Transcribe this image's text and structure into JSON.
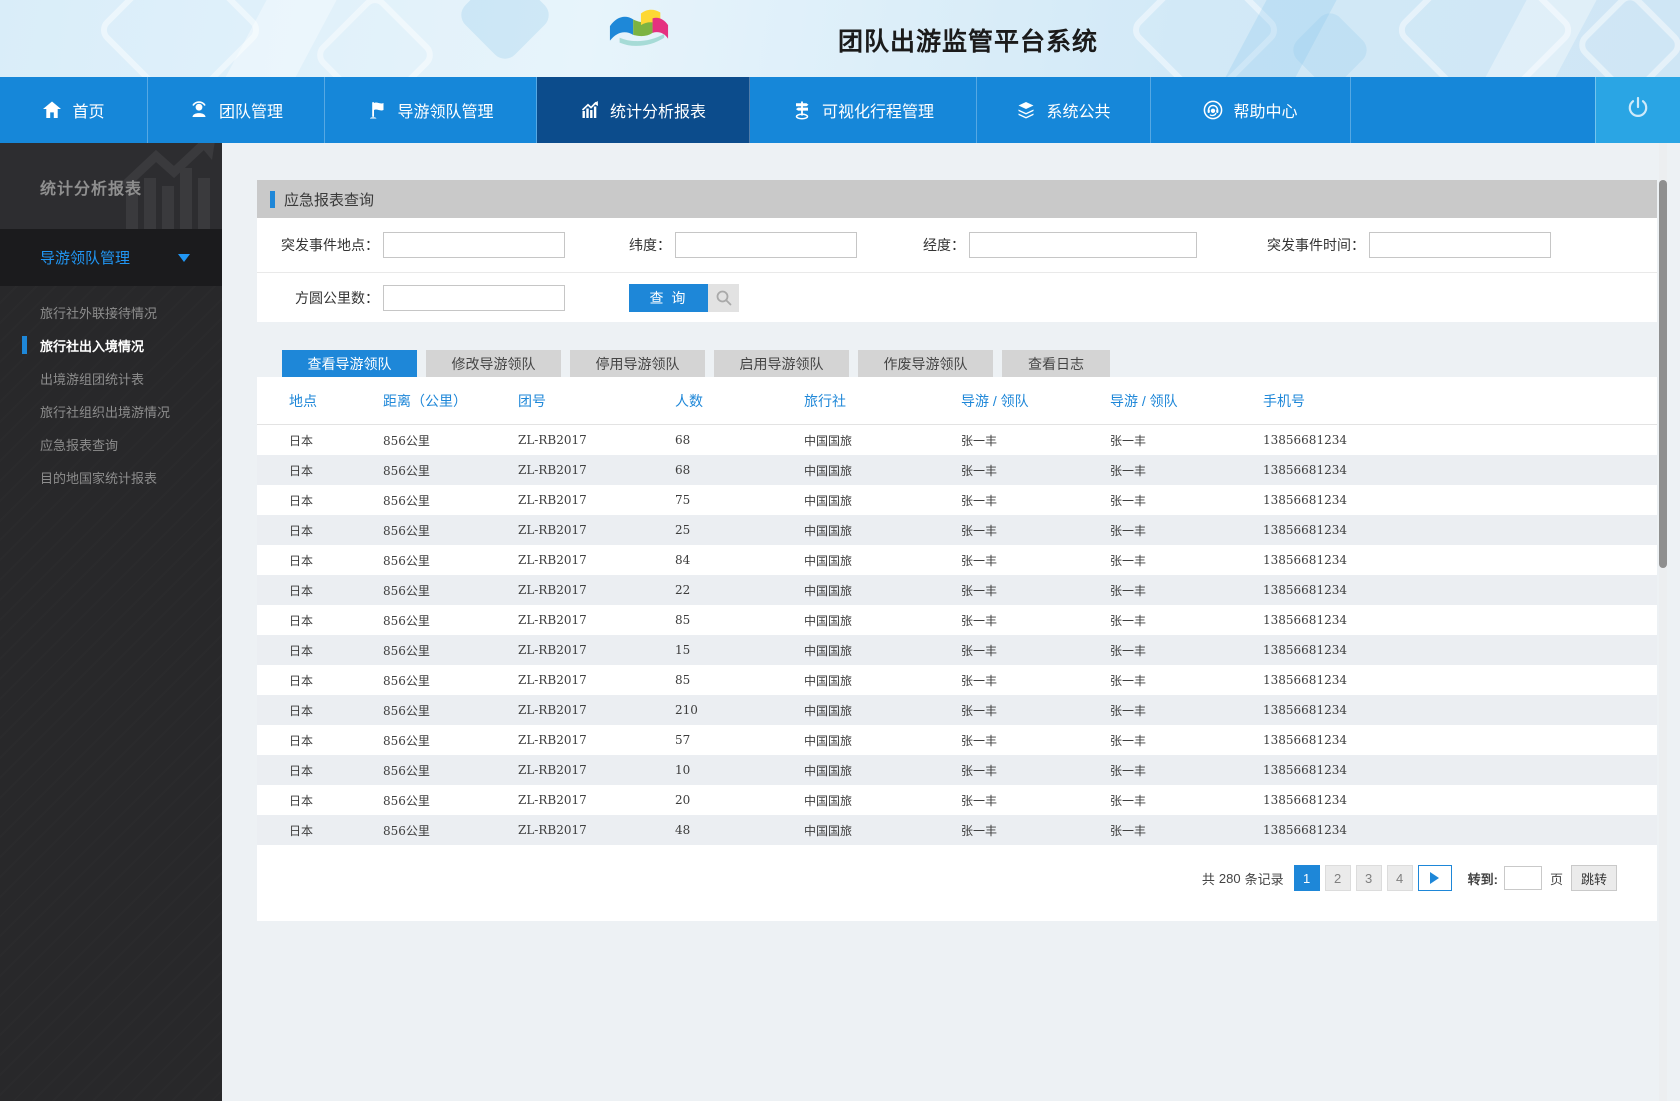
{
  "colors": {
    "accent": "#1e87d8",
    "nav_bg": "#1687d9",
    "nav_active_bg": "#0c4c8c",
    "power_section_bg": "#2aa5e4",
    "sidebar_bg": "#28282a",
    "sidebar_link": "#2196f3",
    "panel_header_bg": "#c9c9c9",
    "row_stripe": "#ebeef2",
    "page_bg": "#edf1f4"
  },
  "header": {
    "title": "团队出游监管平台系统"
  },
  "nav": {
    "items": [
      {
        "id": "home",
        "label": "首页"
      },
      {
        "id": "team-management",
        "label": "团队管理"
      },
      {
        "id": "guide-leader-management",
        "label": "导游领队管理"
      },
      {
        "id": "statistics-reports",
        "label": "统计分析报表",
        "active": true
      },
      {
        "id": "visual-itinerary-management",
        "label": "可视化行程管理"
      },
      {
        "id": "system-public",
        "label": "系统公共"
      },
      {
        "id": "help-center",
        "label": "帮助中心"
      }
    ]
  },
  "sidebar": {
    "title": "统计分析报表",
    "group": "导游领队管理",
    "items": [
      {
        "id": "agency-outreach-reception",
        "label": "旅行社外联接待情况"
      },
      {
        "id": "agency-entry-exit",
        "label": "旅行社出入境情况",
        "active": true
      },
      {
        "id": "outbound-group-statistics",
        "label": "出境游组团统计表"
      },
      {
        "id": "agency-organized-outbound",
        "label": "旅行社组织出境游情况"
      },
      {
        "id": "emergency-report-query",
        "label": "应急报表查询"
      },
      {
        "id": "destination-country-statistics",
        "label": "目的地国家统计报表"
      }
    ]
  },
  "search_panel": {
    "title": "应急报表查询",
    "fields": {
      "incident_location": "突发事件地点：",
      "latitude": "纬度：",
      "longitude": "经度：",
      "incident_time": "突发事件时间：",
      "radius_km": "方圆公里数："
    },
    "query_button": "查 询"
  },
  "tabs": [
    {
      "id": "view-guides",
      "label": "查看导游领队",
      "active": true
    },
    {
      "id": "modify-guides",
      "label": "修改导游领队"
    },
    {
      "id": "disable-guides",
      "label": "停用导游领队"
    },
    {
      "id": "enable-guides",
      "label": "启用导游领队"
    },
    {
      "id": "void-guides",
      "label": "作废导游领队"
    },
    {
      "id": "view-logs",
      "label": "查看日志"
    }
  ],
  "table": {
    "columns": [
      "地点",
      "距离（公里）",
      "团号",
      "人数",
      "旅行社",
      "导游 / 领队",
      "导游 / 领队",
      "手机号"
    ],
    "rows": [
      [
        "日本",
        "856公里",
        "ZL-RB2017",
        "68",
        "中国国旅",
        "张一丰",
        "张一丰",
        "13856681234"
      ],
      [
        "日本",
        "856公里",
        "ZL-RB2017",
        "68",
        "中国国旅",
        "张一丰",
        "张一丰",
        "13856681234"
      ],
      [
        "日本",
        "856公里",
        "ZL-RB2017",
        "75",
        "中国国旅",
        "张一丰",
        "张一丰",
        "13856681234"
      ],
      [
        "日本",
        "856公里",
        "ZL-RB2017",
        "25",
        "中国国旅",
        "张一丰",
        "张一丰",
        "13856681234"
      ],
      [
        "日本",
        "856公里",
        "ZL-RB2017",
        "84",
        "中国国旅",
        "张一丰",
        "张一丰",
        "13856681234"
      ],
      [
        "日本",
        "856公里",
        "ZL-RB2017",
        "22",
        "中国国旅",
        "张一丰",
        "张一丰",
        "13856681234"
      ],
      [
        "日本",
        "856公里",
        "ZL-RB2017",
        "85",
        "中国国旅",
        "张一丰",
        "张一丰",
        "13856681234"
      ],
      [
        "日本",
        "856公里",
        "ZL-RB2017",
        "15",
        "中国国旅",
        "张一丰",
        "张一丰",
        "13856681234"
      ],
      [
        "日本",
        "856公里",
        "ZL-RB2017",
        "85",
        "中国国旅",
        "张一丰",
        "张一丰",
        "13856681234"
      ],
      [
        "日本",
        "856公里",
        "ZL-RB2017",
        "210",
        "中国国旅",
        "张一丰",
        "张一丰",
        "13856681234"
      ],
      [
        "日本",
        "856公里",
        "ZL-RB2017",
        "57",
        "中国国旅",
        "张一丰",
        "张一丰",
        "13856681234"
      ],
      [
        "日本",
        "856公里",
        "ZL-RB2017",
        "10",
        "中国国旅",
        "张一丰",
        "张一丰",
        "13856681234"
      ],
      [
        "日本",
        "856公里",
        "ZL-RB2017",
        "20",
        "中国国旅",
        "张一丰",
        "张一丰",
        "13856681234"
      ],
      [
        "日本",
        "856公里",
        "ZL-RB2017",
        "48",
        "中国国旅",
        "张一丰",
        "张一丰",
        "13856681234"
      ]
    ]
  },
  "pagination": {
    "total_prefix": "共",
    "total_count": "280",
    "total_suffix": "条记录",
    "pages": [
      {
        "label": "1",
        "active": true
      },
      {
        "label": "2"
      },
      {
        "label": "3"
      },
      {
        "label": "4"
      }
    ],
    "goto_label": "转到:",
    "page_unit": "页",
    "jump_button": "跳转"
  }
}
